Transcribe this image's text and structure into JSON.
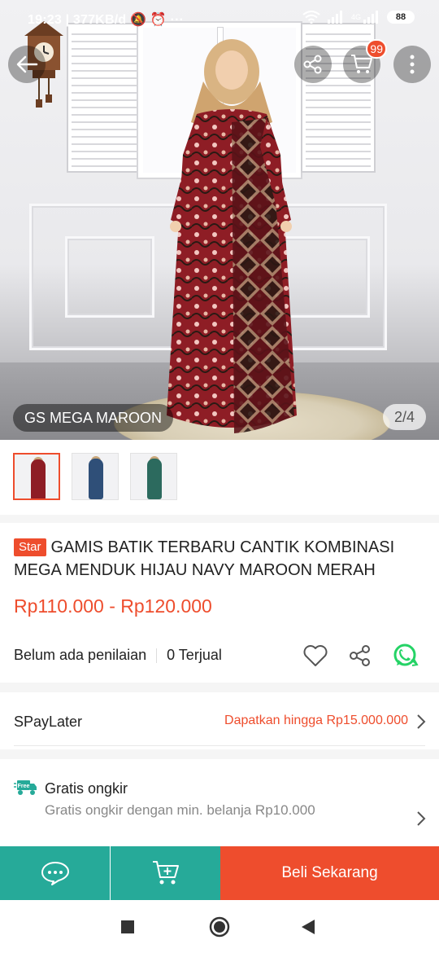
{
  "status_bar": {
    "time": "19:23",
    "speed": "377KB/d",
    "battery": "88",
    "network": "4G"
  },
  "hero": {
    "variant_label": "GS MEGA MAROON",
    "image_counter": "2/4",
    "cart_count": "99"
  },
  "thumbnails": [
    {
      "color": "#8e1d25",
      "selected": true
    },
    {
      "color": "#2f4f78",
      "selected": false
    },
    {
      "color": "#2c6a5e",
      "selected": false
    }
  ],
  "product": {
    "badge": "Star",
    "title": "GAMIS BATIK TERBARU CANTIK KOMBINASI MEGA MENDUK HIJAU NAVY MAROON MERAH",
    "price": "Rp110.000 - Rp120.000",
    "rating_text": "Belum ada penilaian",
    "sold_text": "0 Terjual"
  },
  "spaylater": {
    "label": "SPayLater",
    "offer": "Dapatkan hingga Rp15.000.000"
  },
  "shipping": {
    "badge": "Free",
    "title": "Gratis ongkir",
    "subtitle": "Gratis ongkir dengan min. belanja Rp10.000"
  },
  "bottom_bar": {
    "buy_label": "Beli Sekarang"
  },
  "colors": {
    "accent": "#ee4d2d",
    "teal": "#26aa99",
    "whatsapp": "#25d366"
  }
}
